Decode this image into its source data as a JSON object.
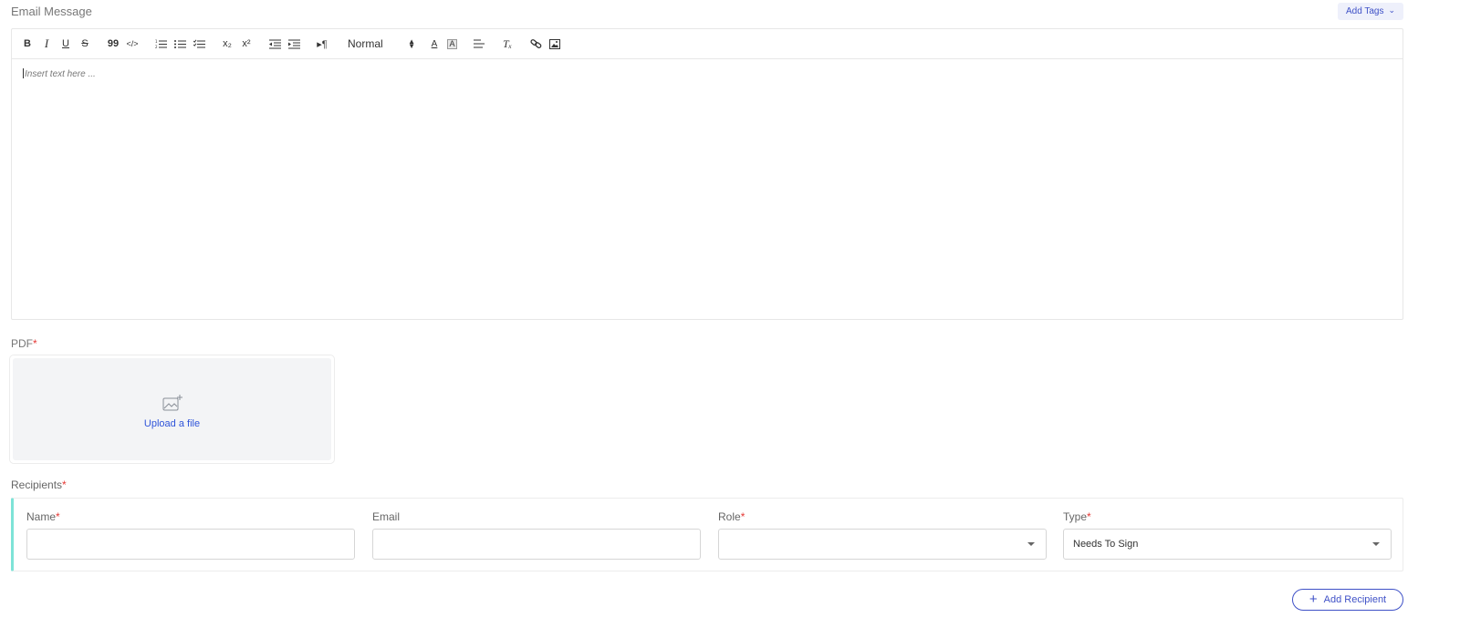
{
  "email_message": {
    "label": "Email Message",
    "add_tags_label": "Add Tags",
    "editor": {
      "format_select": "Normal",
      "placeholder": "Insert text here ...",
      "toolbar": {
        "bold": "B",
        "italic": "I",
        "underline": "U",
        "strike": "S",
        "quote": "99",
        "code": "</>",
        "subscript": "x₂",
        "superscript": "x²",
        "direction": "▸¶",
        "color": "A",
        "background": "A",
        "clear": "Tₓ"
      }
    }
  },
  "pdf": {
    "label": "PDF",
    "required_mark": "*",
    "upload_label": "Upload a file"
  },
  "recipients": {
    "label": "Recipients",
    "required_mark": "*",
    "fields": {
      "name": {
        "label": "Name",
        "required_mark": "*",
        "value": ""
      },
      "email": {
        "label": "Email",
        "value": ""
      },
      "role": {
        "label": "Role",
        "required_mark": "*",
        "value": ""
      },
      "type": {
        "label": "Type",
        "required_mark": "*",
        "value": "Needs To Sign"
      }
    },
    "add_button_label": "Add Recipient"
  },
  "colors": {
    "accent": "#3f51c7",
    "link": "#2f54d9",
    "required": "#e53935",
    "panel_border_accent": "#7ee3d7"
  }
}
